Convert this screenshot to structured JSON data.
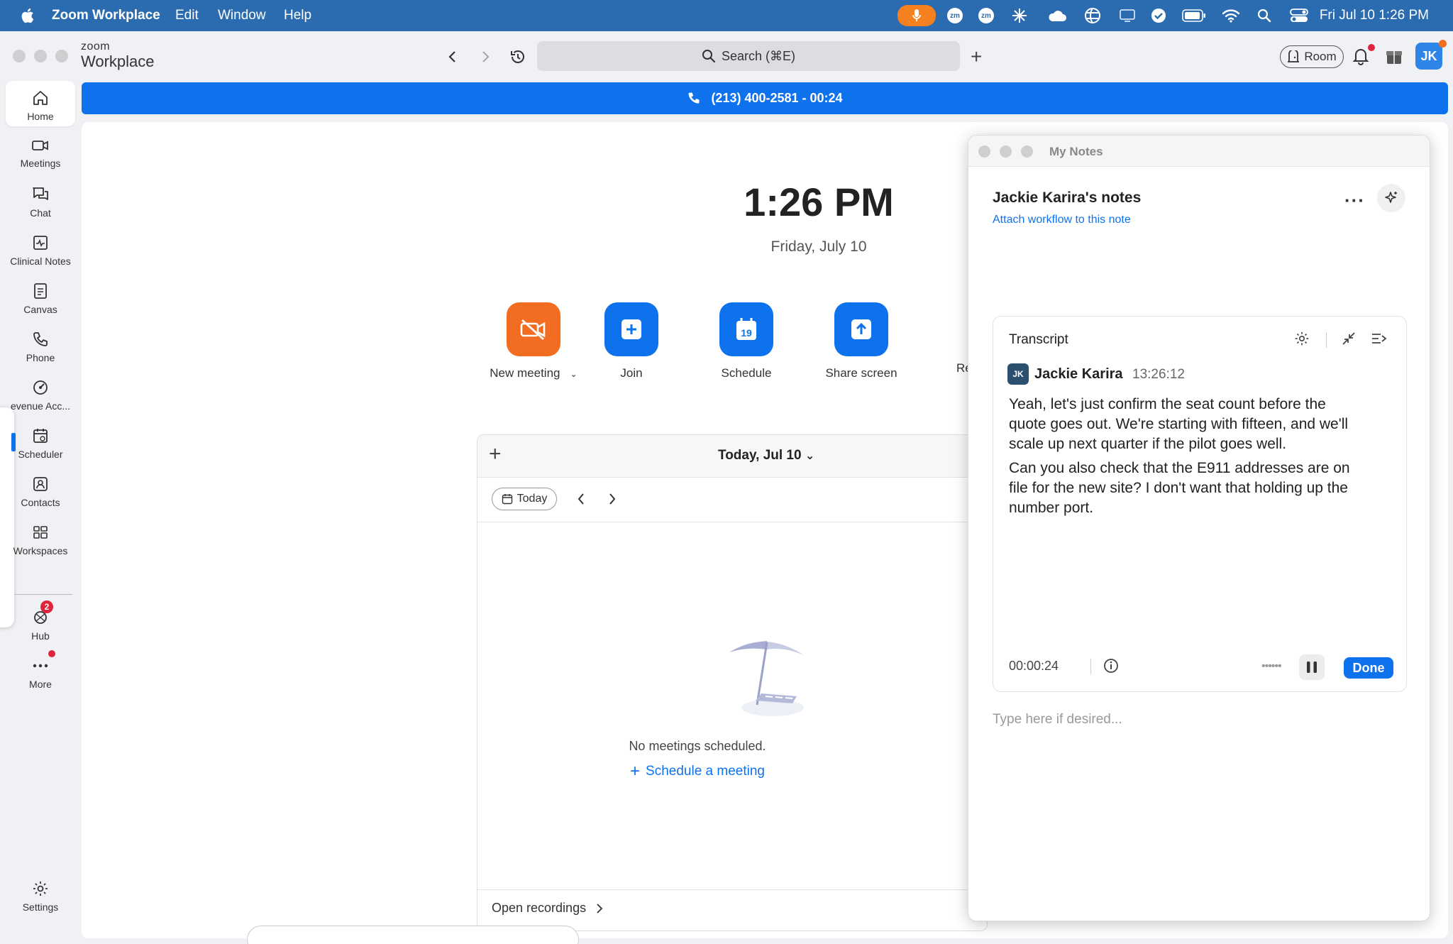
{
  "menubar": {
    "app_name": "Zoom Workplace",
    "items": [
      "Edit",
      "Window",
      "Help"
    ],
    "clock": "Fri Jul 10  1:26 PM",
    "zm1": "zm",
    "zm2": "zm"
  },
  "window": {
    "logo_small": "zoom",
    "logo_big": "Workplace",
    "search_text": "Search (⌘E)",
    "room_label": "Room",
    "avatar_initials": "JK"
  },
  "sidebar": {
    "items": [
      {
        "label": "Home",
        "icon": "home-icon"
      },
      {
        "label": "Meetings",
        "icon": "video-icon"
      },
      {
        "label": "Chat",
        "icon": "chat-icon"
      },
      {
        "label": "Clinical Notes",
        "icon": "clinical-notes-icon"
      },
      {
        "label": "Canvas",
        "icon": "canvas-icon"
      },
      {
        "label": "Phone",
        "icon": "phone-icon"
      },
      {
        "label": "evenue Acc...",
        "icon": "gauge-icon"
      },
      {
        "label": "Scheduler",
        "icon": "scheduler-icon"
      },
      {
        "label": "Contacts",
        "icon": "contacts-icon"
      },
      {
        "label": "Workspaces",
        "icon": "workspaces-icon"
      },
      {
        "label": "Hub",
        "icon": "hub-icon"
      },
      {
        "label": "More",
        "icon": "more-icon"
      }
    ],
    "hub_badge": "2",
    "settings_label": "Settings"
  },
  "call_banner": {
    "text": "(213) 400-2581 - 00:24"
  },
  "home": {
    "time": "1:26 PM",
    "date": "Friday, July 10",
    "actions": {
      "new_meeting": "New meeting",
      "join": "Join",
      "schedule": "Schedule",
      "schedule_day": "19",
      "share_screen": "Share screen",
      "cut_off": "Re"
    },
    "calendar": {
      "title": "Today, Jul 10",
      "today_btn": "Today",
      "empty_text": "No meetings scheduled.",
      "schedule_link": "Schedule a meeting",
      "open_recordings": "Open recordings"
    }
  },
  "notes": {
    "window_title": "My Notes",
    "heading": "Jackie Karira's notes",
    "attach_link": "Attach workflow to this note",
    "transcript": {
      "title": "Transcript",
      "speaker_initials": "JK",
      "speaker": "Jackie Karira",
      "timestamp": "13:26:12",
      "paragraph1": "Yeah, let's just confirm the seat count before the quote goes out. We're starting with fifteen, and we'll scale up next quarter if the pilot goes well.",
      "paragraph2": "Can you also check that the E911 addresses are on file for the new site? I don't want that holding up the number port.",
      "timer": "00:00:24",
      "done": "Done"
    },
    "input_placeholder": "Type here if desired..."
  },
  "colors": {
    "brand_blue": "#0e72ed",
    "orange": "#f26d21",
    "menubar": "#2b6cb0",
    "badge_red": "#e0243b"
  }
}
